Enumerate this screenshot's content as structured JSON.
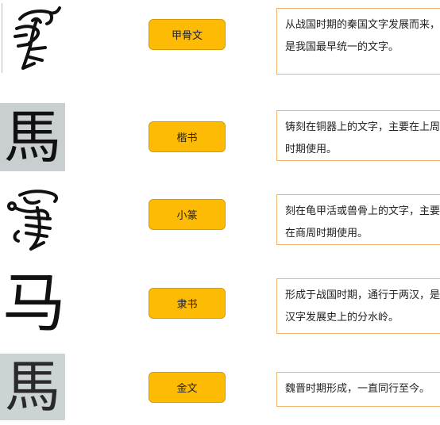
{
  "rows": [
    {
      "label": "甲骨文",
      "description": "从战国时期的秦国文字发展而来，是我国最早统一的文字。",
      "glyph_icon": "oracle-bone-horse-icon"
    },
    {
      "label": "楷书",
      "description": "铸刻在铜器上的文字，主要在上周时期使用。",
      "glyph_icon": "carved-horse-character-icon",
      "glyph_char": "馬"
    },
    {
      "label": "小篆",
      "description": "刻在龟甲活或兽骨上的文字，主要在商周时期使用。",
      "glyph_icon": "seal-script-horse-icon"
    },
    {
      "label": "隶书",
      "description": "形成于战国时期，通行于两汉，是汉字发展史上的分水岭。",
      "glyph_icon": "simplified-horse-character-icon",
      "glyph_char": "马"
    },
    {
      "label": "金文",
      "description": "魏晋时期形成，一直同行至今。",
      "glyph_icon": "bronze-horse-character-icon",
      "glyph_char": "馬"
    }
  ],
  "colors": {
    "button": "#fdbb06",
    "button_border": "#d89a00",
    "box_border": "#f0b46a"
  }
}
